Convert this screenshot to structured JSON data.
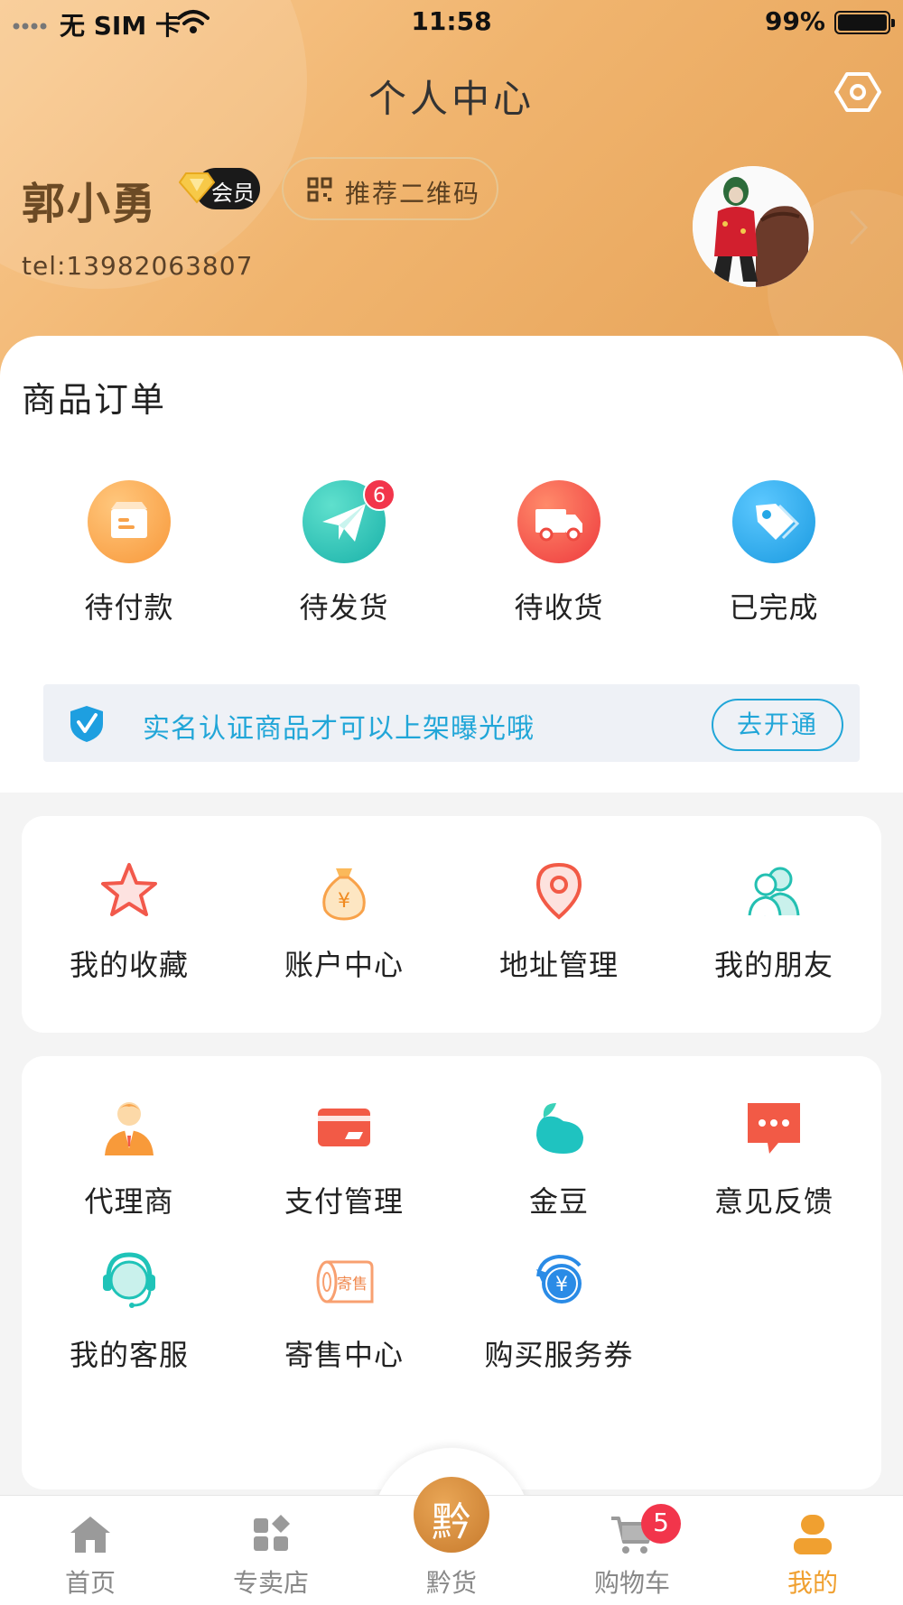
{
  "status_bar": {
    "carrier": "无 SIM 卡",
    "time": "11:58",
    "battery": "99%"
  },
  "header": {
    "title": "个人中心"
  },
  "user": {
    "name": "郭小勇",
    "vip_label": "会员",
    "qr_button": "推荐二维码",
    "phone": "tel:13982063807"
  },
  "orders": {
    "title": "商品订单",
    "items": [
      {
        "label": "待付款",
        "icon": "package-icon",
        "color": "#f8a24a",
        "badge": null
      },
      {
        "label": "待发货",
        "icon": "paper-plane-icon",
        "color": "#27c3b6",
        "badge": "6"
      },
      {
        "label": "待收货",
        "icon": "truck-icon",
        "color": "#f25a46",
        "badge": null
      },
      {
        "label": "已完成",
        "icon": "tag-icon",
        "color": "#24a7e6",
        "badge": null
      }
    ]
  },
  "verify": {
    "text": "实名认证商品才可以上架曝光哦",
    "button": "去开通"
  },
  "services1": [
    {
      "label": "我的收藏",
      "icon": "star-icon"
    },
    {
      "label": "账户中心",
      "icon": "money-bag-icon"
    },
    {
      "label": "地址管理",
      "icon": "location-pin-icon"
    },
    {
      "label": "我的朋友",
      "icon": "friends-icon"
    }
  ],
  "services2": [
    {
      "label": "代理商",
      "icon": "agent-icon"
    },
    {
      "label": "支付管理",
      "icon": "card-icon"
    },
    {
      "label": "金豆",
      "icon": "bean-icon"
    },
    {
      "label": "意见反馈",
      "icon": "feedback-icon"
    },
    {
      "label": "我的客服",
      "icon": "customer-service-icon"
    },
    {
      "label": "寄售中心",
      "icon": "consignment-icon",
      "icon_text": "寄售"
    },
    {
      "label": "购买服务券",
      "icon": "service-coupon-icon"
    }
  ],
  "tabbar": {
    "items": [
      {
        "label": "首页",
        "icon": "home-icon"
      },
      {
        "label": "专卖店",
        "icon": "store-icon"
      },
      {
        "label": "黔货",
        "icon": "qian-logo-icon",
        "glyph": "黔"
      },
      {
        "label": "购物车",
        "icon": "cart-icon",
        "badge": "5"
      },
      {
        "label": "我的",
        "icon": "profile-icon",
        "active": true
      }
    ]
  },
  "colors": {
    "accent": "#f0a030",
    "header_gradient_start": "#f9c98f",
    "header_gradient_end": "#e6a257",
    "verify_blue": "#21a6d8",
    "badge_red": "#f2354b"
  }
}
